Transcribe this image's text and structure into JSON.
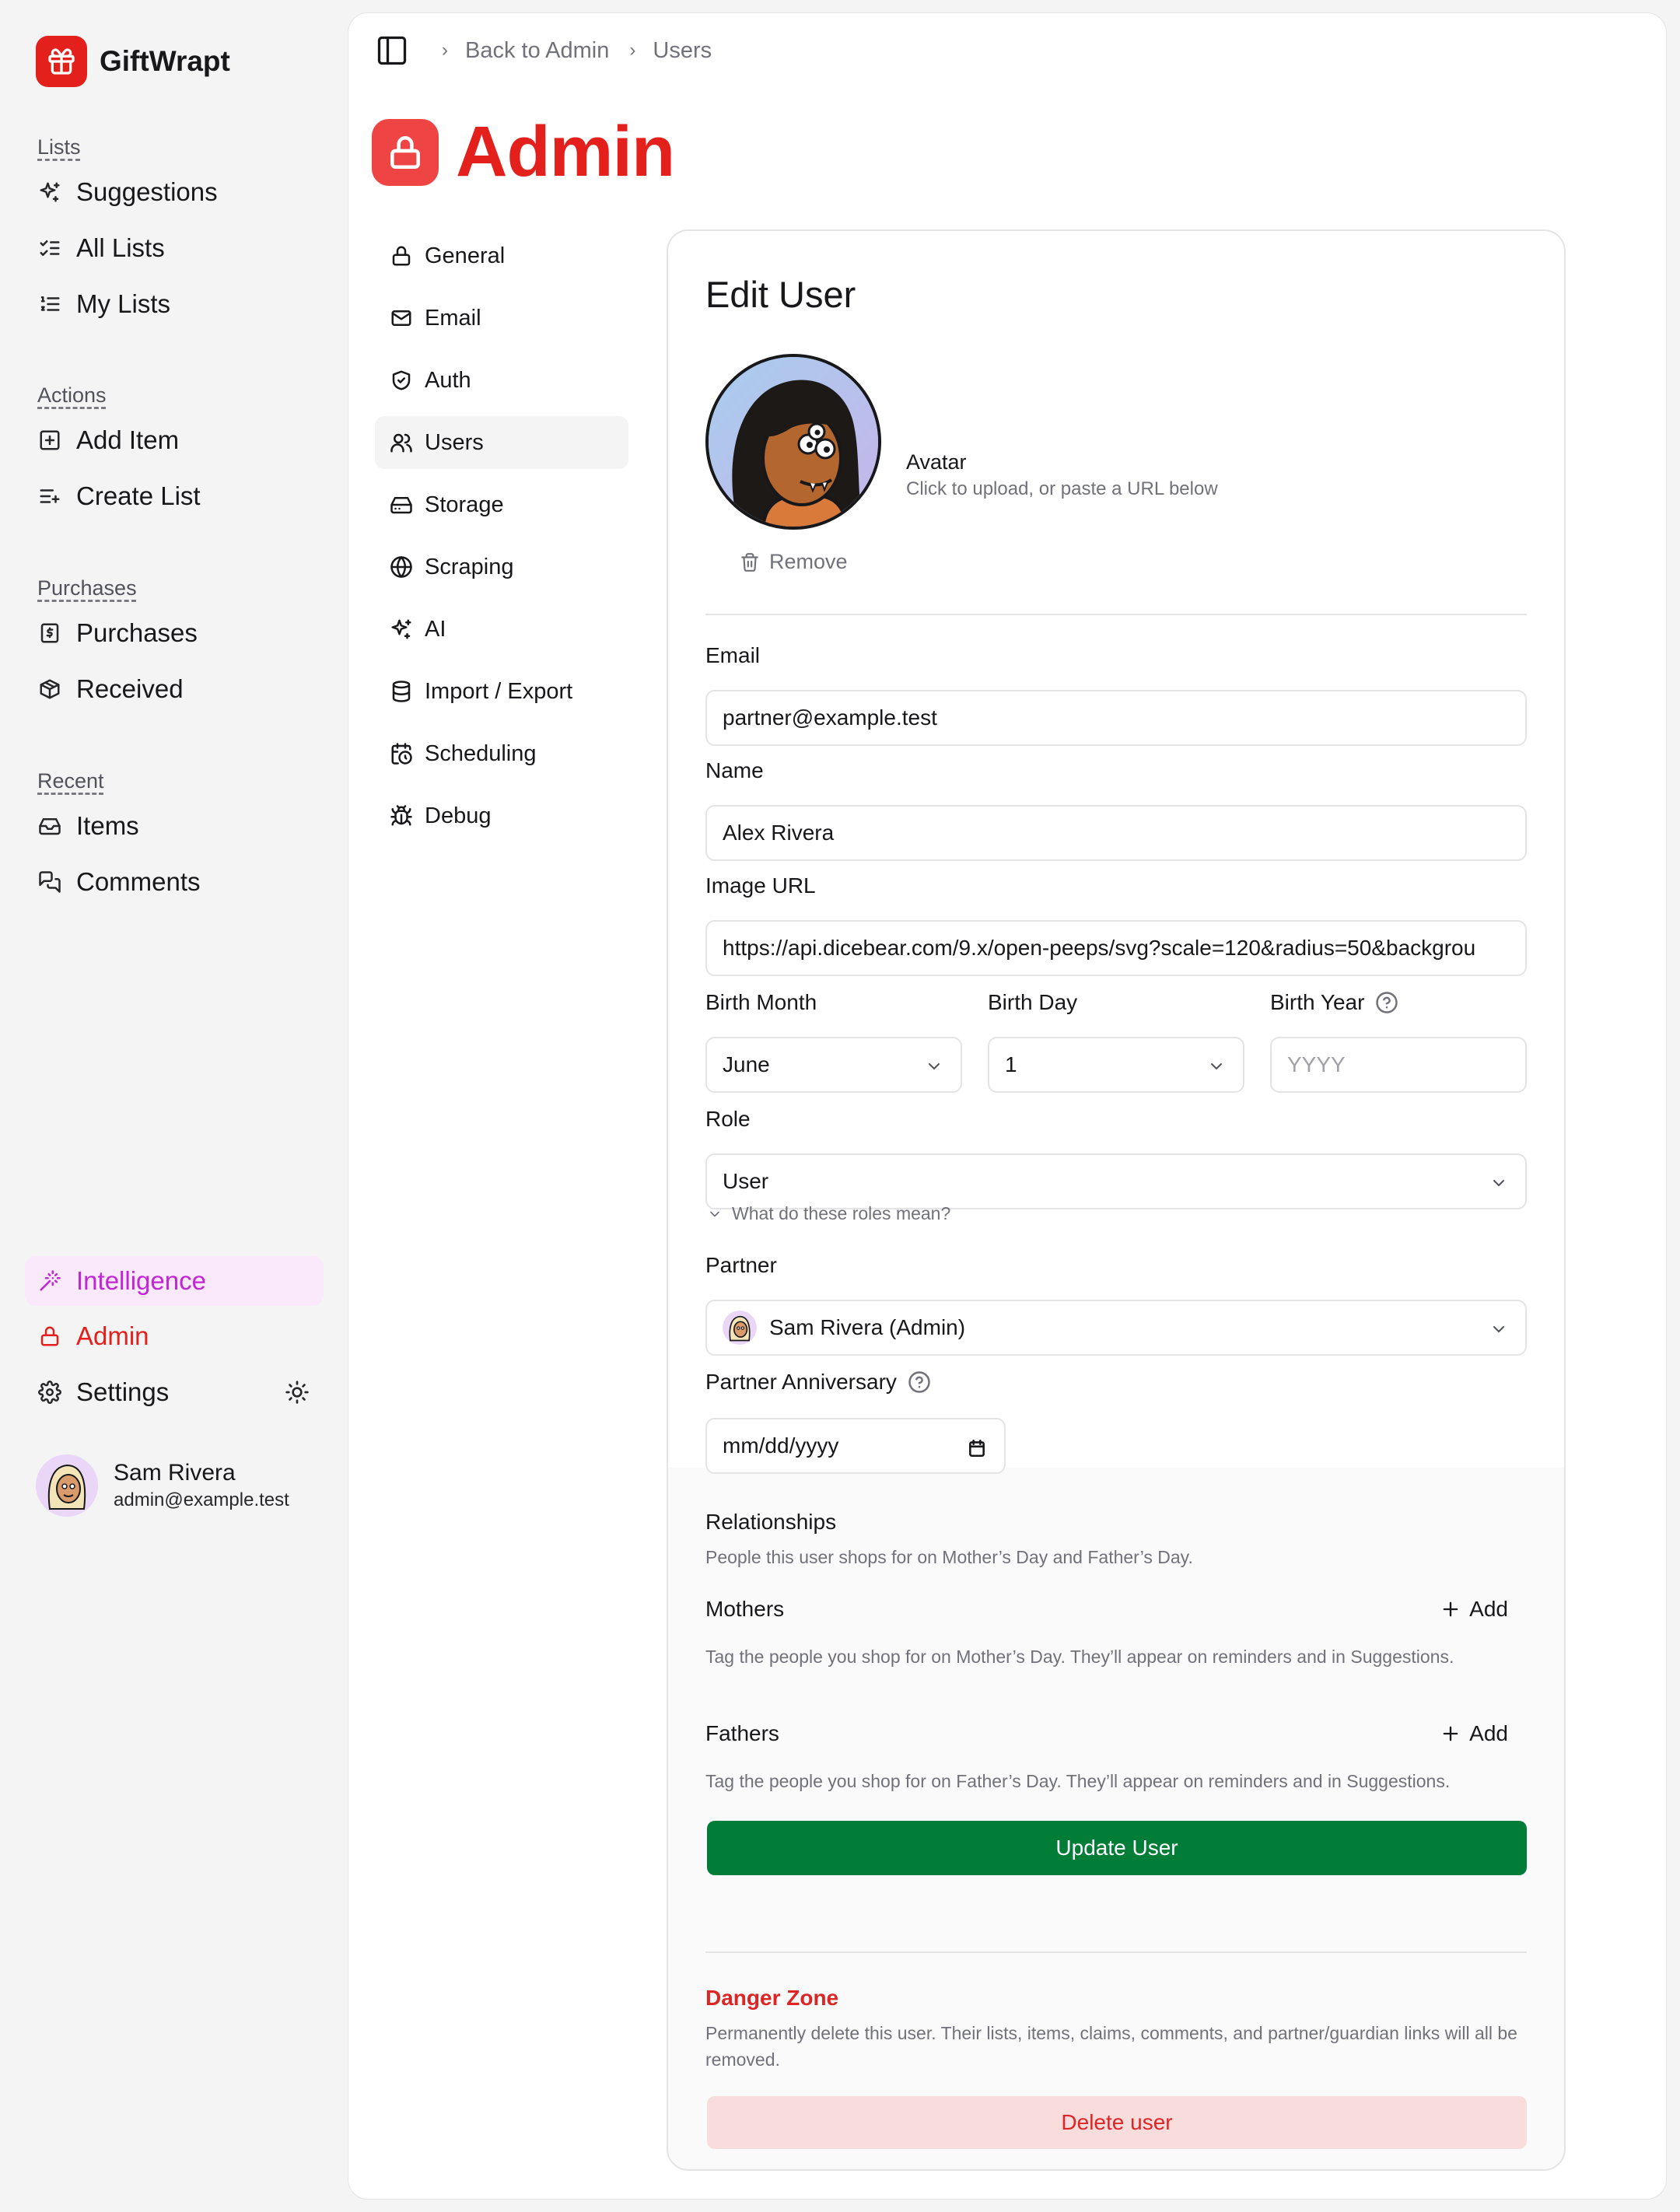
{
  "app": {
    "name": "GiftWrapt"
  },
  "sidebar": {
    "sections": [
      {
        "header": "Lists",
        "items": [
          {
            "label": "Suggestions",
            "icon": "sparkles-icon"
          },
          {
            "label": "All Lists",
            "icon": "list-checks-icon"
          },
          {
            "label": "My Lists",
            "icon": "list-ordered-icon"
          }
        ]
      },
      {
        "header": "Actions",
        "items": [
          {
            "label": "Add Item",
            "icon": "square-plus-icon"
          },
          {
            "label": "Create List",
            "icon": "list-plus-icon"
          }
        ]
      },
      {
        "header": "Purchases",
        "items": [
          {
            "label": "Purchases",
            "icon": "receipt-icon"
          },
          {
            "label": "Received",
            "icon": "package-icon"
          }
        ]
      },
      {
        "header": "Recent",
        "items": [
          {
            "label": "Items",
            "icon": "inbox-icon"
          },
          {
            "label": "Comments",
            "icon": "messages-icon"
          }
        ]
      }
    ],
    "bottom": {
      "intelligence": "Intelligence",
      "admin": "Admin",
      "settings": "Settings"
    },
    "user": {
      "name": "Sam Rivera",
      "email": "admin@example.test"
    }
  },
  "breadcrumb": {
    "back": "Back to Admin",
    "current": "Users"
  },
  "page": {
    "title": "Admin"
  },
  "admin_nav": [
    {
      "label": "General",
      "icon": "lock-icon"
    },
    {
      "label": "Email",
      "icon": "mail-icon"
    },
    {
      "label": "Auth",
      "icon": "shield-icon"
    },
    {
      "label": "Users",
      "icon": "users-icon",
      "active": true
    },
    {
      "label": "Storage",
      "icon": "hard-drive-icon"
    },
    {
      "label": "Scraping",
      "icon": "globe-icon"
    },
    {
      "label": "AI",
      "icon": "sparkles-icon"
    },
    {
      "label": "Import / Export",
      "icon": "database-icon"
    },
    {
      "label": "Scheduling",
      "icon": "calendar-clock-icon"
    },
    {
      "label": "Debug",
      "icon": "bug-icon"
    }
  ],
  "form": {
    "title": "Edit User",
    "avatar": {
      "label": "Avatar",
      "hint": "Click to upload, or paste a URL below",
      "remove": "Remove"
    },
    "email": {
      "label": "Email",
      "value": "partner@example.test"
    },
    "name": {
      "label": "Name",
      "value": "Alex Rivera"
    },
    "image_url": {
      "label": "Image URL",
      "value": "https://api.dicebear.com/9.x/open-peeps/svg?scale=120&radius=50&backgrou"
    },
    "birth_month": {
      "label": "Birth Month",
      "value": "June"
    },
    "birth_day": {
      "label": "Birth Day",
      "value": "1"
    },
    "birth_year": {
      "label": "Birth Year",
      "placeholder": "YYYY"
    },
    "role": {
      "label": "Role",
      "value": "User",
      "help": "What do these roles mean?"
    },
    "partner": {
      "label": "Partner",
      "value": "Sam Rivera (Admin)"
    },
    "anniversary": {
      "label": "Partner Anniversary",
      "placeholder": "mm/dd/yyyy"
    },
    "relationships": {
      "title": "Relationships",
      "desc": "People this user shops for on Mother’s Day and Father’s Day.",
      "mothers": {
        "title": "Mothers",
        "add": "Add",
        "desc": "Tag the people you shop for on Mother’s Day. They’ll appear on reminders and in Suggestions."
      },
      "fathers": {
        "title": "Fathers",
        "add": "Add",
        "desc": "Tag the people you shop for on Father’s Day. They’ll appear on reminders and in Suggestions."
      }
    },
    "update": "Update User",
    "danger": {
      "title": "Danger Zone",
      "desc": "Permanently delete this user. Their lists, items, claims, comments, and partner/guardian links will all be removed.",
      "delete": "Delete user"
    }
  },
  "colors": {
    "brand": "#e3201b",
    "intelligence": "#c026d3",
    "update": "#027d38",
    "danger": "#dc2626"
  }
}
